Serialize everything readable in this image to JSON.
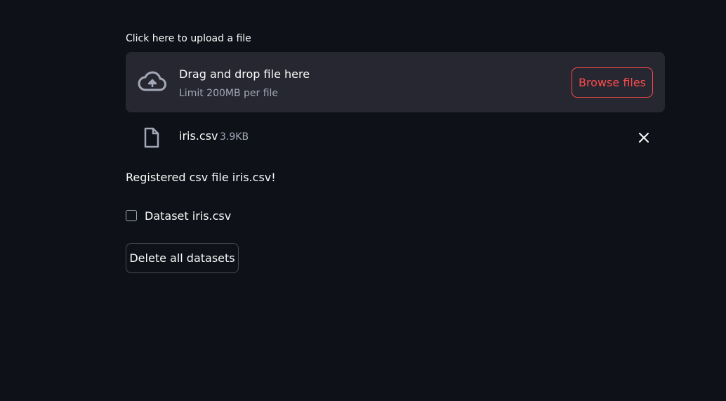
{
  "uploader": {
    "label": "Click here to upload a file",
    "dropzone_title": "Drag and drop file here",
    "limit_text": "Limit 200MB per file",
    "browse_label": "Browse files",
    "cloud_icon": "cloud-upload-icon"
  },
  "uploaded_file": {
    "name": "iris.csv",
    "size": "3.9KB",
    "file_icon": "file-icon",
    "remove_icon": "close-icon"
  },
  "status_message": "Registered csv file iris.csv!",
  "dataset_checkbox": {
    "label": "Dataset iris.csv",
    "checked": false
  },
  "delete_button_label": "Delete all datasets",
  "colors": {
    "background": "#0e1117",
    "dropzone": "#262730",
    "accent": "#ff4b4b",
    "text": "#fafafa",
    "muted_text": "#a3a8b8"
  }
}
